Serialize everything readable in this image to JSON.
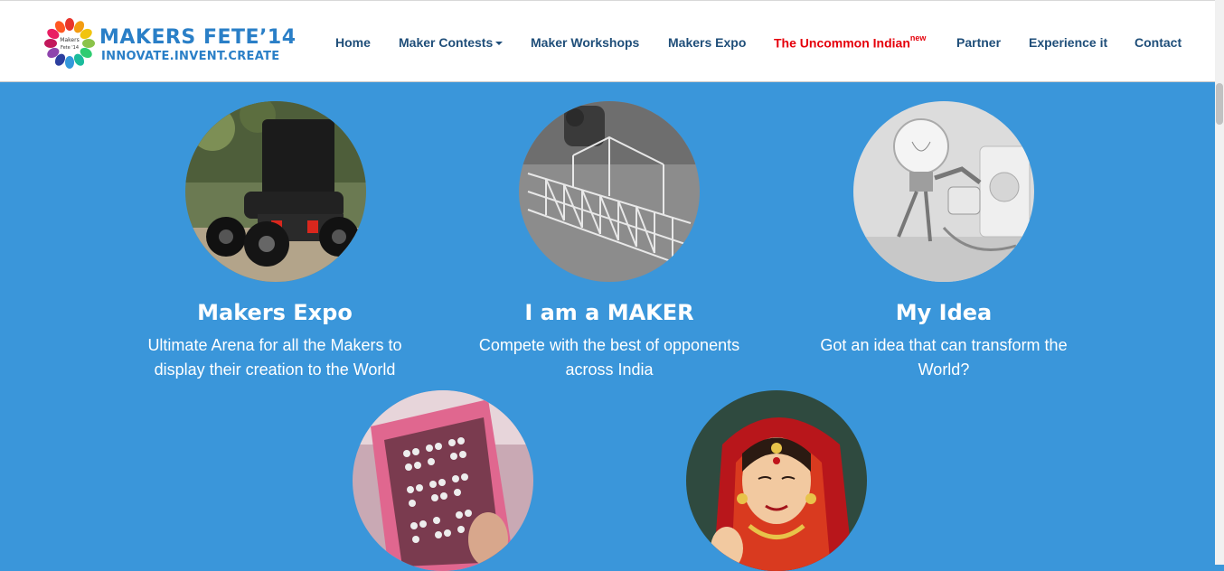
{
  "brand": {
    "title": "MAKERS FETE’14",
    "tagline": "INNOVATE.INVENT.CREATE",
    "mark_text_1": "Makers",
    "mark_text_2": "Fete '14"
  },
  "nav": {
    "items": [
      {
        "label": "Home"
      },
      {
        "label": "Maker Contests"
      },
      {
        "label": "Maker Workshops"
      },
      {
        "label": "Makers Expo"
      },
      {
        "label": "The Uncommon Indian",
        "badge": "new"
      },
      {
        "label": "Partner"
      },
      {
        "label": "Experience it"
      },
      {
        "label": "Contact"
      }
    ]
  },
  "features": [
    {
      "title": "Makers Expo",
      "desc_line1": "Ultimate Arena for all the Makers to",
      "desc_line2": "display their creation to the World",
      "image": "wheelchair-photo"
    },
    {
      "title": "I am a MAKER",
      "desc_line1": "Compete with the best of opponents",
      "desc_line2": "across India",
      "image": "bridge-model-photo"
    },
    {
      "title": "My Idea",
      "desc_line1": "Got an idea that can transform the",
      "desc_line2": "World?",
      "image": "bulb-robot-photo"
    },
    {
      "image": "braille-sheet-photo"
    },
    {
      "image": "indian-painting-photo"
    }
  ],
  "colors": {
    "background": "#3a96da",
    "nav_text": "#1f4e79",
    "nav_highlight": "#e5000b",
    "brand": "#2a7fc7"
  }
}
